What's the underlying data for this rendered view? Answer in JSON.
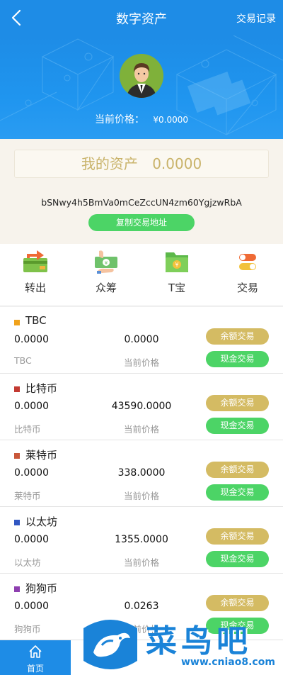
{
  "header": {
    "title": "数字资产",
    "records_label": "交易记录"
  },
  "hero": {
    "price_label": "当前价格：",
    "price_value": "¥0.0000"
  },
  "asset": {
    "label": "我的资产",
    "amount": "0.0000",
    "address": "bSNwy4h5BmVa0mCeZccUN4zm60YgjzwRbA",
    "copy_button": "复制交易地址"
  },
  "quicknav": [
    {
      "label": "转出",
      "icon": "transfer-out-icon"
    },
    {
      "label": "众筹",
      "icon": "crowdfunding-icon"
    },
    {
      "label": "T宝",
      "icon": "tbao-wallet-icon"
    },
    {
      "label": "交易",
      "icon": "trade-toggle-icon"
    }
  ],
  "coins": [
    {
      "name": "TBC",
      "balance": "0.0000",
      "price": "0.0000",
      "symbol": "TBC",
      "price_label": "当前价格",
      "color": "#f0a21b",
      "balance_btn": "余额交易",
      "cash_btn": "现金交易"
    },
    {
      "name": "比特币",
      "balance": "0.0000",
      "price": "43590.0000",
      "symbol": "比特币",
      "price_label": "当前价格",
      "color": "#c33a32",
      "balance_btn": "余额交易",
      "cash_btn": "现金交易"
    },
    {
      "name": "莱特币",
      "balance": "0.0000",
      "price": "338.0000",
      "symbol": "莱特币",
      "price_label": "当前价格",
      "color": "#c9573a",
      "balance_btn": "余额交易",
      "cash_btn": "现金交易"
    },
    {
      "name": "以太坊",
      "balance": "0.0000",
      "price": "1355.0000",
      "symbol": "以太坊",
      "price_label": "当前价格",
      "color": "#3157c2",
      "balance_btn": "余额交易",
      "cash_btn": "现金交易"
    },
    {
      "name": "狗狗币",
      "balance": "0.0000",
      "price": "0.0263",
      "symbol": "狗狗币",
      "price_label": "当前价格",
      "color": "#8e3fb0",
      "balance_btn": "余额交易",
      "cash_btn": "现金交易"
    }
  ],
  "tabbar": {
    "home_label": "首页"
  },
  "watermark": {
    "title": "菜鸟吧",
    "url": "www.cniao8.com"
  },
  "colors": {
    "primary": "#1e8ce6",
    "gold": "#d4bb63",
    "green": "#4cd466"
  }
}
